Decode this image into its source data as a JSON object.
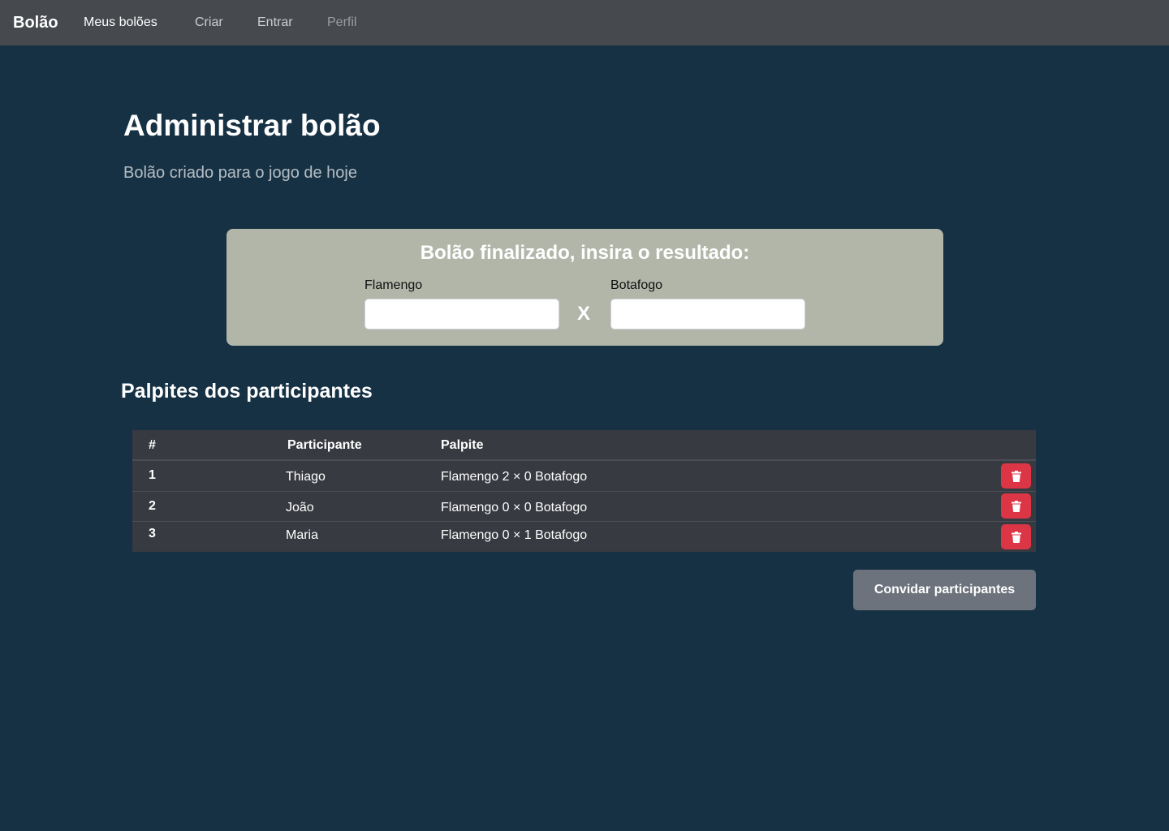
{
  "navbar": {
    "brand": "Bolão",
    "links": [
      {
        "label": "Meus bolões",
        "state": "active"
      },
      {
        "label": "Criar",
        "state": "normal"
      },
      {
        "label": "Entrar",
        "state": "normal"
      },
      {
        "label": "Perfil",
        "state": "disabled"
      }
    ]
  },
  "page": {
    "title": "Administrar bolão",
    "subtitle": "Bolão criado para o jogo de hoje"
  },
  "result_card": {
    "heading": "Bolão finalizado, insira o resultado:",
    "home_team": "Flamengo",
    "away_team": "Botafogo",
    "home_score": "",
    "away_score": "",
    "separator": "X"
  },
  "guesses": {
    "title": "Palpites dos participantes",
    "columns": [
      "#",
      "Participante",
      "Palpite"
    ],
    "rows": [
      {
        "num": "1",
        "participant": "Thiago",
        "guess": "Flamengo 2 × 0 Botafogo"
      },
      {
        "num": "2",
        "participant": "João",
        "guess": "Flamengo 0 × 0 Botafogo"
      },
      {
        "num": "3",
        "participant": "Maria",
        "guess": "Flamengo 0 × 1 Botafogo"
      }
    ],
    "delete_icon": "trash-icon"
  },
  "invite_button": "Convidar participantes",
  "colors": {
    "background": "#163144",
    "navbar": "#464a4e",
    "card": "#b1b6a9",
    "table": "#373a40",
    "danger": "#dc3545",
    "secondary": "#6c737c"
  }
}
